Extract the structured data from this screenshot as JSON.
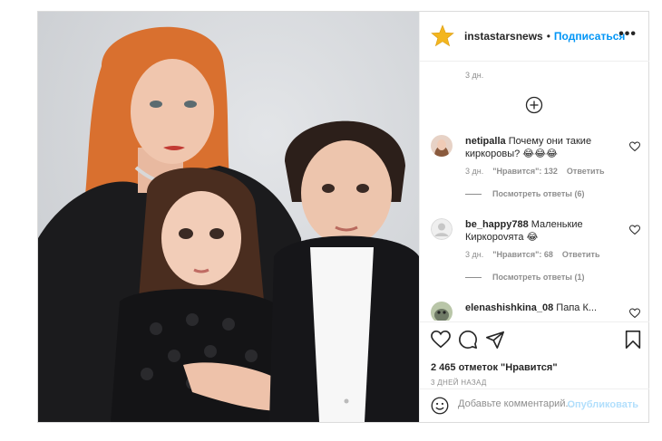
{
  "header": {
    "username": "instastarsnews",
    "separator": "•",
    "follow_label": "Подписаться",
    "more_label": "•••"
  },
  "comments": {
    "top_time": "3 дн.",
    "items": [
      {
        "username": "netipalla",
        "text": "Почему они такие киркоровы?",
        "emojis": "😂😂😂",
        "time": "3 дн.",
        "likes": "\"Нравится\": 132",
        "reply": "Ответить",
        "view_replies": "Посмотреть ответы (6)"
      },
      {
        "username": "be_happy788",
        "text": "Маленькие Киркорovята",
        "emojis": "😂",
        "time": "3 дн.",
        "likes": "\"Нравится\": 68",
        "reply": "Ответить",
        "view_replies": "Посмотреть ответы (1)"
      },
      {
        "username": "elenashishkina_08",
        "text": "Папа К...",
        "emojis": "",
        "time": "",
        "likes": "",
        "reply": "",
        "view_replies": ""
      }
    ]
  },
  "footer": {
    "likes_count": "2 465 отметок \"Нравится\"",
    "post_date": "3 ДНЕЙ НАЗАД",
    "comment_placeholder": "Добавьте комментарий...",
    "publish_label": "Опубликовать"
  },
  "colors": {
    "accent": "#0095f6",
    "publish_disabled": "#b2dffc",
    "muted": "#8e8e8e",
    "border": "#dbdbdb"
  },
  "icons": [
    "star-avatar-icon",
    "more-icon",
    "plus-circle-icon",
    "heart-icon",
    "comment-icon",
    "share-icon",
    "bookmark-icon",
    "emoji-icon"
  ]
}
